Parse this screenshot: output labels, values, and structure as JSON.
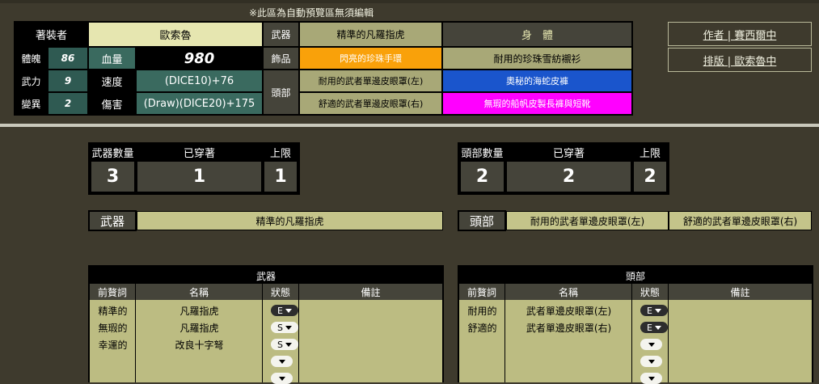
{
  "notice": "※此區為自動預覽區無須編輯",
  "wearer": {
    "label": "著裝者",
    "name": "歐索魯"
  },
  "stats": [
    {
      "label": "體魄",
      "value": "86"
    },
    {
      "label": "武力",
      "value": "9"
    },
    {
      "label": "變異",
      "value": "2"
    }
  ],
  "hp": {
    "label": "血量",
    "value": "980"
  },
  "speed": {
    "label": "速度",
    "value": "(DICE10)+76"
  },
  "damage": {
    "label": "傷害",
    "value": "(Draw)(DICE20)+175"
  },
  "equip": {
    "weapon_label": "武器",
    "weapon_value": "精準的凡羅指虎",
    "accessory_label": "飾品",
    "accessory_value": "閃亮的珍珠手環",
    "head_label": "頭部",
    "head_value_1": "耐用的武者單邊皮眼罩(左)",
    "head_value_2": "舒適的武者單邊皮眼罩(右)",
    "body_label": "身　體",
    "body_1": "耐用的珍珠雪紡襯衫",
    "body_2": "奧秘的海蛇皮褲",
    "body_3": "無瑕的船帆皮製長褲與短靴"
  },
  "colors": {
    "accessory": "#f9a10a",
    "body_2": "#1a55cc",
    "body_3": "#ff00ff"
  },
  "credits": {
    "author": "作者 | 賽西爾中",
    "layout": "排版 | 歐索魯中"
  },
  "weapon_count": {
    "count_label": "武器數量",
    "worn_label": "已穿著",
    "limit_label": "上限",
    "count": "3",
    "worn": "1",
    "limit": "1"
  },
  "head_count": {
    "count_label": "頭部數量",
    "worn_label": "已穿著",
    "limit_label": "上限",
    "count": "2",
    "worn": "2",
    "limit": "2"
  },
  "weapon_bar": {
    "label": "武器",
    "value": "精準的凡羅指虎"
  },
  "head_bar": {
    "label": "頭部",
    "value_1": "耐用的武者單邊皮眼罩(左)",
    "value_2": "舒適的武者單邊皮眼罩(右)"
  },
  "weapon_table": {
    "title": "武器",
    "headers": [
      "前贅詞",
      "名稱",
      "狀態",
      "備註"
    ],
    "rows": [
      {
        "prefix": "精準的",
        "name": "凡羅指虎",
        "status": "E"
      },
      {
        "prefix": "無瑕的",
        "name": "凡羅指虎",
        "status": "S"
      },
      {
        "prefix": "幸運的",
        "name": "改良十字弩",
        "status": "S"
      }
    ]
  },
  "head_table": {
    "title": "頭部",
    "headers": [
      "前贅詞",
      "名稱",
      "狀態",
      "備註"
    ],
    "rows": [
      {
        "prefix": "耐用的",
        "name": "武者單邊皮眼罩(左)",
        "status": "E"
      },
      {
        "prefix": "舒適的",
        "name": "武者單邊皮眼罩(右)",
        "status": "E"
      }
    ]
  }
}
